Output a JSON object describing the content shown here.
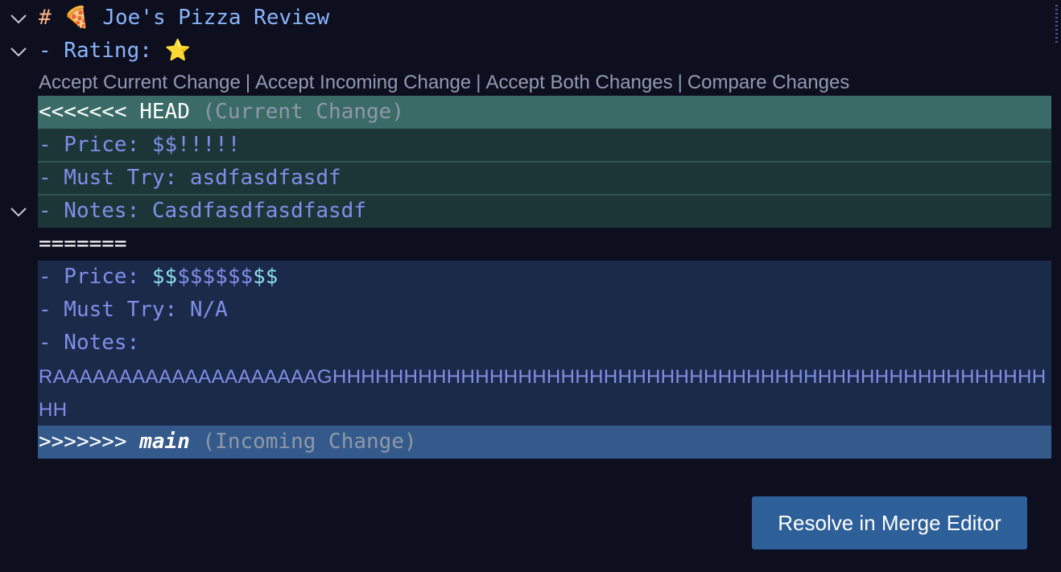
{
  "editor": {
    "heading": {
      "hash": "#",
      "emoji": "🍕",
      "title": "Joe's Pizza Review"
    },
    "rating": {
      "text": "- Rating:",
      "emoji": "⭐"
    },
    "codelens": {
      "accept_current": "Accept Current Change",
      "accept_incoming": "Accept Incoming Change",
      "accept_both": "Accept Both Changes",
      "compare": "Compare Changes",
      "separator": "|"
    },
    "current": {
      "marker": "<<<<<<<",
      "branch": "HEAD",
      "label": "(Current Change)",
      "price_prefix": "- Price: ",
      "price_value": "$$!!!!!",
      "must_try": "- Must Try: asdfasdfasdf",
      "notes": "- Notes: Casdfasdfasdfasdf"
    },
    "separator_line": "=======",
    "incoming": {
      "price_prefix": "- Price: ",
      "price_value_a": "$$",
      "price_value_b": "$$$$$$",
      "price_value_c": "$$",
      "must_try": "- Must Try: N/A",
      "notes": "- Notes:",
      "notes_continued": "RAAAAAAAAAAAAAAAAAAAAGHHHHHHHHHHHHHHHHHHHHHHHHHHHHHHHHHHHHHHHHHHHHHHHHHHHH",
      "marker": ">>>>>>>",
      "branch": "main",
      "label": "(Incoming Change)"
    }
  },
  "resolve_button": {
    "label": "Resolve in Merge Editor"
  },
  "colors": {
    "background": "#0d0f1f",
    "current_header": "#3a6b66",
    "current_body": "#1c3638",
    "incoming_body": "#1c2a4a",
    "incoming_header": "#345a8c",
    "button": "#2d5f99"
  },
  "icons": {
    "fold": "chevron-down-icon",
    "pizza": "pizza-emoji",
    "star": "star-emoji"
  }
}
